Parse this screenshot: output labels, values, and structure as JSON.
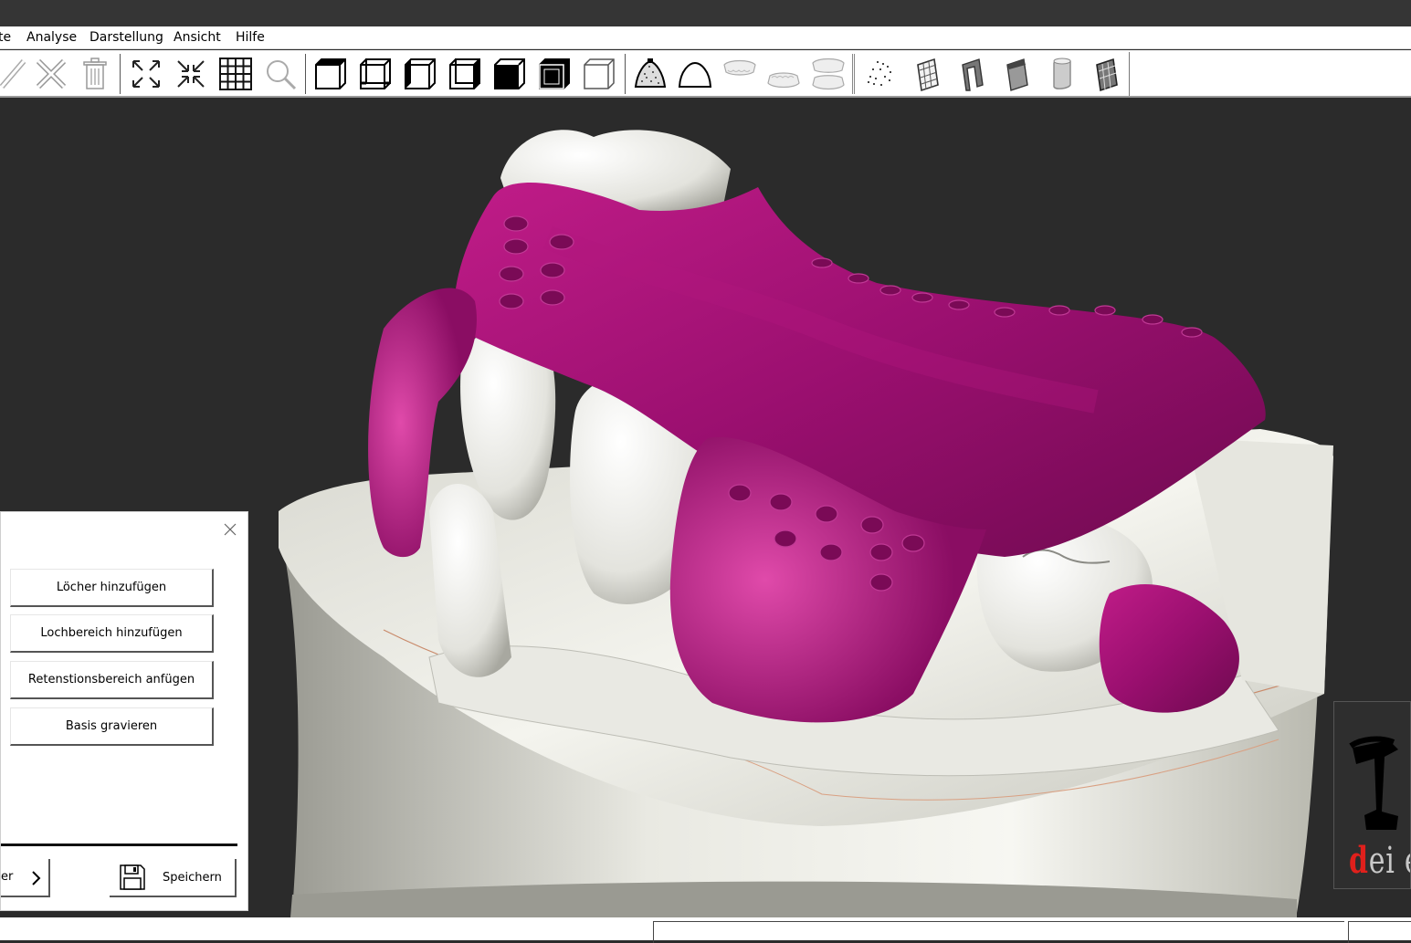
{
  "menubar": {
    "items": [
      "te",
      "Analyse",
      "Darstellung",
      "Ansicht",
      "Hilfe"
    ]
  },
  "toolbar": {
    "groups": [
      [
        "ruler-icon",
        "ruler-cross-icon",
        "trash-icon"
      ],
      [
        "expand-icon",
        "collapse-icon",
        "grid-icon",
        "magnifier-icon"
      ],
      [
        "view-front-icon",
        "view-back-icon",
        "view-left-icon",
        "view-right-icon",
        "view-top-icon",
        "view-bottom-icon",
        "view-iso-icon"
      ],
      [
        "base-dome-icon",
        "arch-icon",
        "upper-jaw-icon",
        "lower-jaw-icon",
        "both-jaws-icon"
      ],
      [
        "pointcloud-icon",
        "wireframe-die-icon",
        "die-shell-icon",
        "die-solid-icon",
        "cylinder-icon",
        "mesh-die-icon"
      ]
    ]
  },
  "panel": {
    "buttons": [
      "Löcher hinzufügen",
      "Lochbereich hinzufügen",
      "Retenstionsbereich anfügen",
      "Basis gravieren"
    ],
    "back_label": "er",
    "save_label": "Speichern"
  },
  "logo": {
    "text_red": "d",
    "text_rest": "ei e"
  },
  "colors": {
    "splint": "#9c1070",
    "model": "#eeeee8",
    "viewport_bg": "#2b2b2b"
  }
}
